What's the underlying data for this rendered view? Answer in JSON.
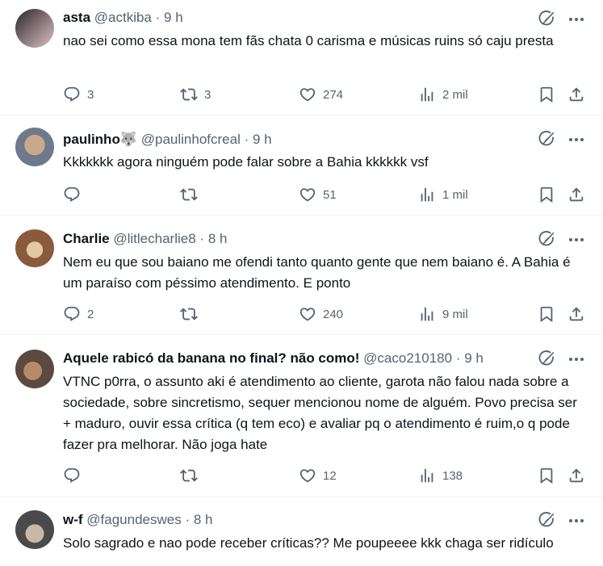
{
  "tweets": [
    {
      "name": "asta",
      "handle": "@actkiba",
      "dot": "·",
      "time": "9 h",
      "text": "nao sei como essa mona tem fãs chata 0 carisma e músicas ruins só caju presta",
      "replies": "3",
      "retweets": "3",
      "likes": "274",
      "views": "2 mil",
      "avatar_colors": [
        "#3a2a2e",
        "#d9c3c8"
      ]
    },
    {
      "name": "paulinho🐺",
      "handle": "@paulinhofcreal",
      "dot": "·",
      "time": "9 h",
      "text": "Kkkkkkk agora ninguém pode falar sobre a Bahia kkkkkk vsf",
      "replies": "",
      "retweets": "",
      "likes": "51",
      "views": "1 mil",
      "avatar_colors": [
        "#6c7a8a",
        "#c9a98c"
      ]
    },
    {
      "name": "Charlie",
      "handle": "@litlecharlie8",
      "dot": "·",
      "time": "8 h",
      "text": "Nem eu que sou baiano me ofendi tanto quanto gente que nem baiano é. A Bahia é um paraíso com péssimo atendimento. E ponto",
      "replies": "2",
      "retweets": "",
      "likes": "240",
      "views": "9 mil",
      "avatar_colors": [
        "#8a5a3c",
        "#e4c7a4"
      ]
    },
    {
      "name": "Aquele rabicó da banana no final? não como!",
      "handle": "@caco210180",
      "dot": "·",
      "time": "9 h",
      "text": "VTNC p0rra, o assunto aki é atendimento ao cliente, garota não falou nada sobre a sociedade, sobre sincretismo, sequer mencionou nome de alguém. Povo precisa ser + maduro, ouvir essa crítica (q tem eco) e avaliar pq o atendimento é ruim,o q pode fazer pra melhorar. Não joga hate",
      "replies": "",
      "retweets": "",
      "likes": "12",
      "views": "138",
      "avatar_colors": [
        "#5a4a40",
        "#b88a6a"
      ]
    },
    {
      "name": "w-f",
      "handle": "@fagundeswes",
      "dot": "·",
      "time": "8 h",
      "text": "Solo sagrado e nao pode receber críticas?? Me poupeeee kkk chaga ser ridículo",
      "replies": "",
      "retweets": "",
      "likes": "",
      "views": "",
      "avatar_colors": [
        "#4a4a4a",
        "#c8b8a8"
      ]
    }
  ],
  "colors": {
    "text": "#0f1419",
    "secondary": "#536471",
    "border": "#eff3f4"
  }
}
